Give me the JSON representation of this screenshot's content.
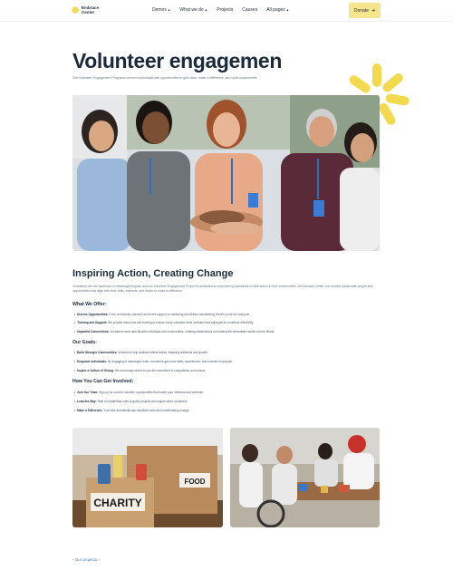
{
  "brand": {
    "line1": "Embrace",
    "line2": "Center"
  },
  "nav": [
    {
      "label": "Demos",
      "dropdown": true
    },
    {
      "label": "What we do",
      "dropdown": true
    },
    {
      "label": "Projects",
      "dropdown": false
    },
    {
      "label": "Causes",
      "dropdown": false
    },
    {
      "label": "All pages",
      "dropdown": true
    }
  ],
  "donate": {
    "label": "Donate",
    "icon": "arrow-right-icon"
  },
  "hero": {
    "title": "Volunteer engagemen",
    "intro": "Our Volunteer Engagement Programs connect individuals with opportunities to give back, make a difference, and uplift communities."
  },
  "section": {
    "title": "Inspiring Action, Creating Change",
    "paragraph": "Volunteers are the backbone of meaningful impact, and our Volunteer Engagement Project is dedicated to empowering individuals to take action in their communities. At Embrace Center, we connect passionate people with opportunities that align with their skills, interests, and desire to make a difference.",
    "offer_title": "What We Offer:",
    "offer": [
      {
        "strong": "Diverse Opportunities:",
        "text": " From community outreach and event support to mentoring and skilled volunteering, there's a role for everyone."
      },
      {
        "strong": "Training and Support:",
        "text": " We provide resources and training to ensure every volunteer feels confident and equipped to contribute effectively."
      },
      {
        "strong": "Impactful Connections:",
        "text": " Volunteers work directly with individuals and communities, creating relationships and seeing the immediate results of their efforts."
      }
    ],
    "goals_title": "Our Goals:",
    "goals": [
      {
        "strong": "Build Stronger Communities:",
        "text": " Volunteers help address critical needs, fostering resilience and growth."
      },
      {
        "strong": "Empower Individuals:",
        "text": " By engaging in meaningful work, volunteers gain new skills, experiences, and a sense of purpose."
      },
      {
        "strong": "Inspire a Culture of Giving:",
        "text": " We encourage others to join the movement of compassion and service."
      }
    ],
    "involve_title": "How You Can Get Involved:",
    "involve": [
      {
        "strong": "Join Our Team:",
        "text": " Sign up for current volunteer opportunities that match your interests and schedule."
      },
      {
        "strong": "Lead the Way:",
        "text": " Take on leadership roles to guide projects and inspire other volunteers."
      },
      {
        "strong": "Make a Difference:",
        "text": " Your time and talents can transform lives and create lasting change."
      }
    ]
  },
  "photos": {
    "box_charity": "CHARITY",
    "box_food": "FOOD"
  },
  "back_link": "Our projects",
  "colors": {
    "accent_yellow": "#f6e58d",
    "burst_yellow": "#f2d94e",
    "heading": "#1c2b3a",
    "link": "#4a7fc1"
  }
}
